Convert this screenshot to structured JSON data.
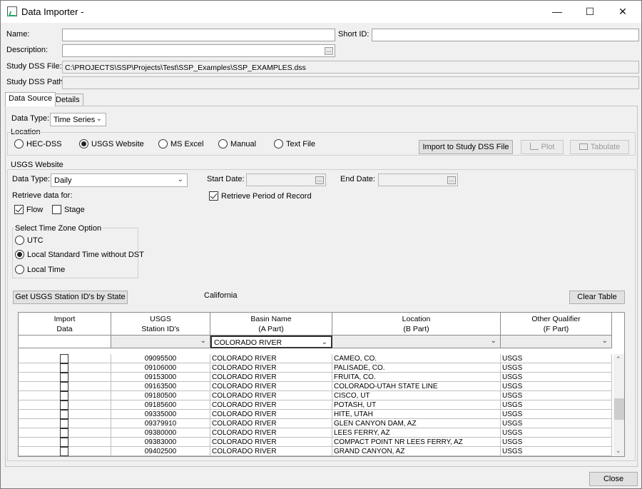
{
  "window": {
    "title": "Data Importer -"
  },
  "form": {
    "name_label": "Name:",
    "name_value": "",
    "shortid_label": "Short ID:",
    "shortid_value": "",
    "description_label": "Description:",
    "description_value": "",
    "dssfile_label": "Study DSS File:",
    "dssfile_value": "C:\\PROJECTS\\SSP\\Projects\\Test\\SSP_Examples\\SSP_EXAMPLES.dss",
    "dsspath_label": "Study DSS Path:",
    "dsspath_value": ""
  },
  "tabs": [
    {
      "label": "Data Source",
      "active": true
    },
    {
      "label": "Details",
      "active": false
    }
  ],
  "datasource": {
    "datatype_label": "Data Type:",
    "datatype_value": "Time Series",
    "location_label": "Location",
    "location_options": [
      "HEC-DSS",
      "USGS Website",
      "MS Excel",
      "Manual",
      "Text File"
    ],
    "location_selected": "USGS Website",
    "import_button": "Import to Study DSS File",
    "plot_button": "Plot",
    "tabulate_button": "Tabulate"
  },
  "usgs": {
    "group_label": "USGS Website",
    "datatype_label": "Data Type:",
    "datatype_value": "Daily",
    "start_label": "Start Date:",
    "start_value": "",
    "end_label": "End Date:",
    "end_value": "",
    "retrieve_label": "Retrieve data for:",
    "flow_label": "Flow",
    "flow_checked": true,
    "stage_label": "Stage",
    "stage_checked": false,
    "por_label": "Retrieve Period of Record",
    "por_checked": true,
    "tz_label": "Select Time Zone Option",
    "tz_options": [
      "UTC",
      "Local Standard Time without DST",
      "Local Time"
    ],
    "tz_selected": "Local Standard Time without DST",
    "get_stations_button": "Get USGS Station ID's by State",
    "state_text": "California",
    "clear_button": "Clear Table"
  },
  "table": {
    "headers": [
      [
        "Import",
        "Data"
      ],
      [
        "USGS",
        "Station ID's"
      ],
      [
        "Basin Name",
        "(A Part)"
      ],
      [
        "Location",
        "(B Part)"
      ],
      [
        "Other Qualifier",
        "(F Part)"
      ]
    ],
    "filter_basin": "COLORADO RIVER",
    "rows": [
      {
        "id": "09095500",
        "basin": "COLORADO RIVER",
        "location": "CAMEO, CO.",
        "qual": "USGS"
      },
      {
        "id": "09106000",
        "basin": "COLORADO RIVER",
        "location": "PALISADE, CO.",
        "qual": "USGS"
      },
      {
        "id": "09153000",
        "basin": "COLORADO RIVER",
        "location": "FRUITA, CO.",
        "qual": "USGS"
      },
      {
        "id": "09163500",
        "basin": "COLORADO RIVER",
        "location": "COLORADO-UTAH STATE LINE",
        "qual": "USGS"
      },
      {
        "id": "09180500",
        "basin": "COLORADO RIVER",
        "location": "CISCO, UT",
        "qual": "USGS"
      },
      {
        "id": "09185600",
        "basin": "COLORADO RIVER",
        "location": "POTASH, UT",
        "qual": "USGS"
      },
      {
        "id": "09335000",
        "basin": "COLORADO RIVER",
        "location": "HITE, UTAH",
        "qual": "USGS"
      },
      {
        "id": "09379910",
        "basin": "COLORADO RIVER",
        "location": "GLEN CANYON DAM, AZ",
        "qual": "USGS"
      },
      {
        "id": "09380000",
        "basin": "COLORADO RIVER",
        "location": "LEES FERRY, AZ",
        "qual": "USGS"
      },
      {
        "id": "09383000",
        "basin": "COLORADO RIVER",
        "location": "COMPACT POINT NR LEES FERRY, AZ",
        "qual": "USGS"
      },
      {
        "id": "09402500",
        "basin": "COLORADO RIVER",
        "location": "GRAND CANYON, AZ",
        "qual": "USGS"
      }
    ]
  },
  "footer": {
    "close_button": "Close"
  }
}
